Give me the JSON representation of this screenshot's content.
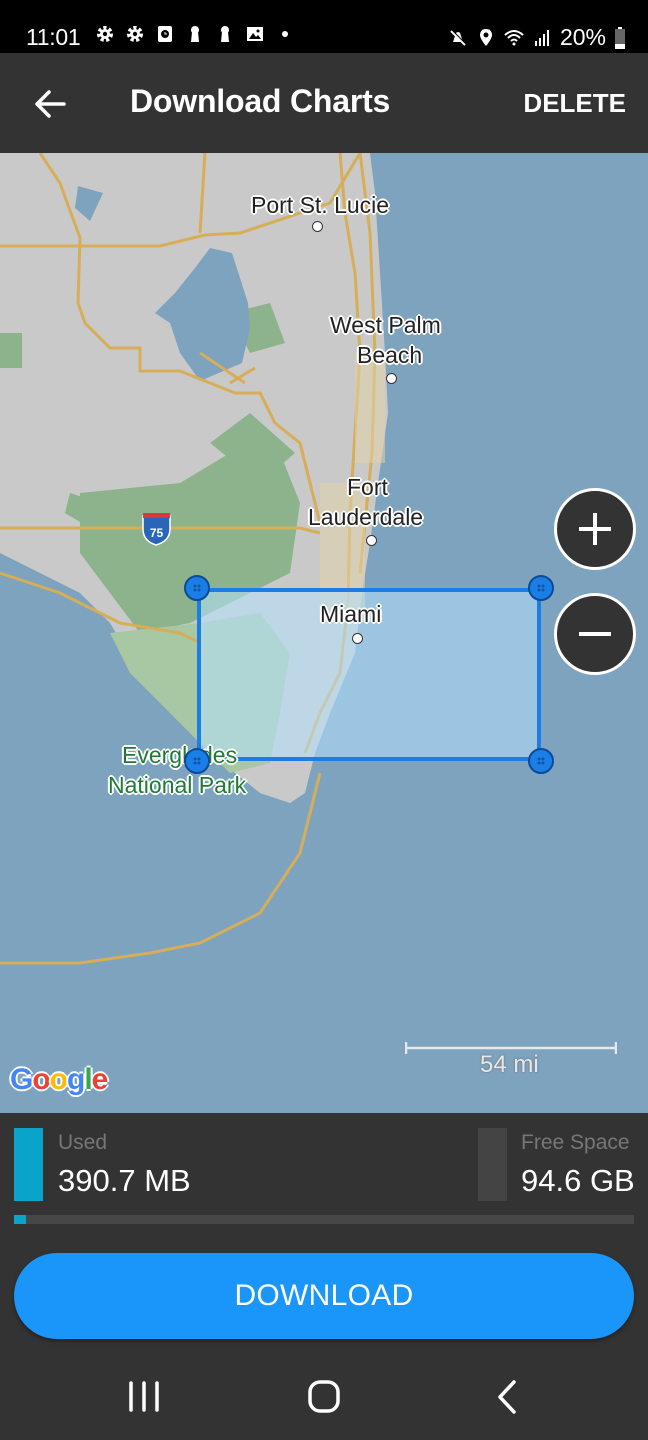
{
  "status_bar": {
    "time": "11:01",
    "left_icons": [
      "gear-icon",
      "gear-icon",
      "clock-app-icon",
      "keyhole-icon",
      "keyhole-icon",
      "image-icon",
      "dot-icon"
    ],
    "right_icons": [
      "mute-icon",
      "location-icon",
      "wifi-icon",
      "signal-icon"
    ],
    "battery": "20%"
  },
  "app_bar": {
    "back_icon": "arrow-left-icon",
    "title": "Download Charts",
    "delete_label": "DELETE"
  },
  "map": {
    "labels": {
      "port_st_lucie": "Port St. Lucie",
      "west_palm_1": "West Palm",
      "west_palm_2": "Beach",
      "fort_1": "Fort",
      "fort_2": "Lauderdale",
      "miami": "Miami",
      "everglades_1": "Everglades",
      "everglades_2": "National Park",
      "highway": "75"
    },
    "zoom_in_icon": "plus-icon",
    "zoom_out_icon": "minus-icon",
    "scale": "54 mi",
    "attribution": "Google",
    "colors": {
      "water": "#7ea3bf",
      "land": "#c8c8c8",
      "park": "#8fb58f",
      "road": "#d6ae57",
      "selection": "#1a7ee6"
    }
  },
  "storage": {
    "used_label": "Used",
    "used_value": "390.7 MB",
    "free_label": "Free Space",
    "free_value": "94.6 GB",
    "used_fraction": 0.004,
    "used_color": "#0aa3c9"
  },
  "download_label": "DOWNLOAD",
  "nav_bar": {
    "recents_icon": "recents-icon",
    "home_icon": "home-icon",
    "back_icon": "back-chevron-icon"
  }
}
